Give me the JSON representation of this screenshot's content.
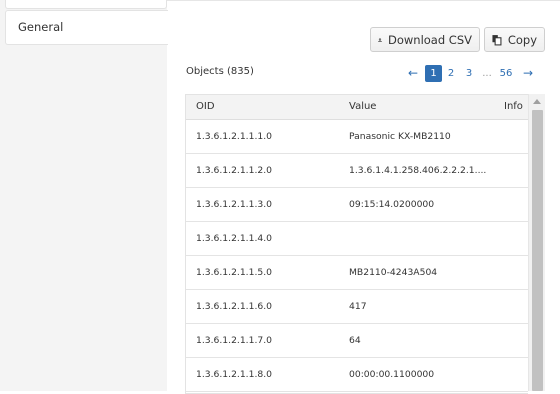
{
  "sidebar": {
    "items": [
      {
        "label": "General"
      }
    ]
  },
  "toolbar": {
    "download_label": "Download CSV",
    "copy_label": "Copy"
  },
  "objects": {
    "label": "Objects (835)"
  },
  "pagination": {
    "prev_arrow": "←",
    "pages": [
      "1",
      "2",
      "3"
    ],
    "active_page": "1",
    "ellipsis": "...",
    "last_page": "56",
    "next_arrow": "→"
  },
  "table": {
    "columns": [
      "OID",
      "Value",
      "Info"
    ],
    "rows": [
      {
        "oid": "1.3.6.1.2.1.1.1.0",
        "value": "Panasonic KX-MB2110",
        "info": ""
      },
      {
        "oid": "1.3.6.1.2.1.1.2.0",
        "value": "1.3.6.1.4.1.258.406.2.2.2.1....",
        "info": ""
      },
      {
        "oid": "1.3.6.1.2.1.1.3.0",
        "value": "09:15:14.0200000",
        "info": ""
      },
      {
        "oid": "1.3.6.1.2.1.1.4.0",
        "value": "",
        "info": ""
      },
      {
        "oid": "1.3.6.1.2.1.1.5.0",
        "value": "MB2110-4243A504",
        "info": ""
      },
      {
        "oid": "1.3.6.1.2.1.1.6.0",
        "value": "417",
        "info": ""
      },
      {
        "oid": "1.3.6.1.2.1.1.7.0",
        "value": "64",
        "info": ""
      },
      {
        "oid": "1.3.6.1.2.1.1.8.0",
        "value": "00:00:00.1100000",
        "info": ""
      }
    ]
  },
  "icons": {
    "download": "download-icon",
    "copy": "copy-icon",
    "scroll_up": "chevron-up-icon"
  },
  "colors": {
    "accent": "#2f6fb3",
    "sidebar_bg": "#f4f4f4",
    "header_bg": "#f3f3f3",
    "scroll_thumb": "#c1c1c1"
  }
}
